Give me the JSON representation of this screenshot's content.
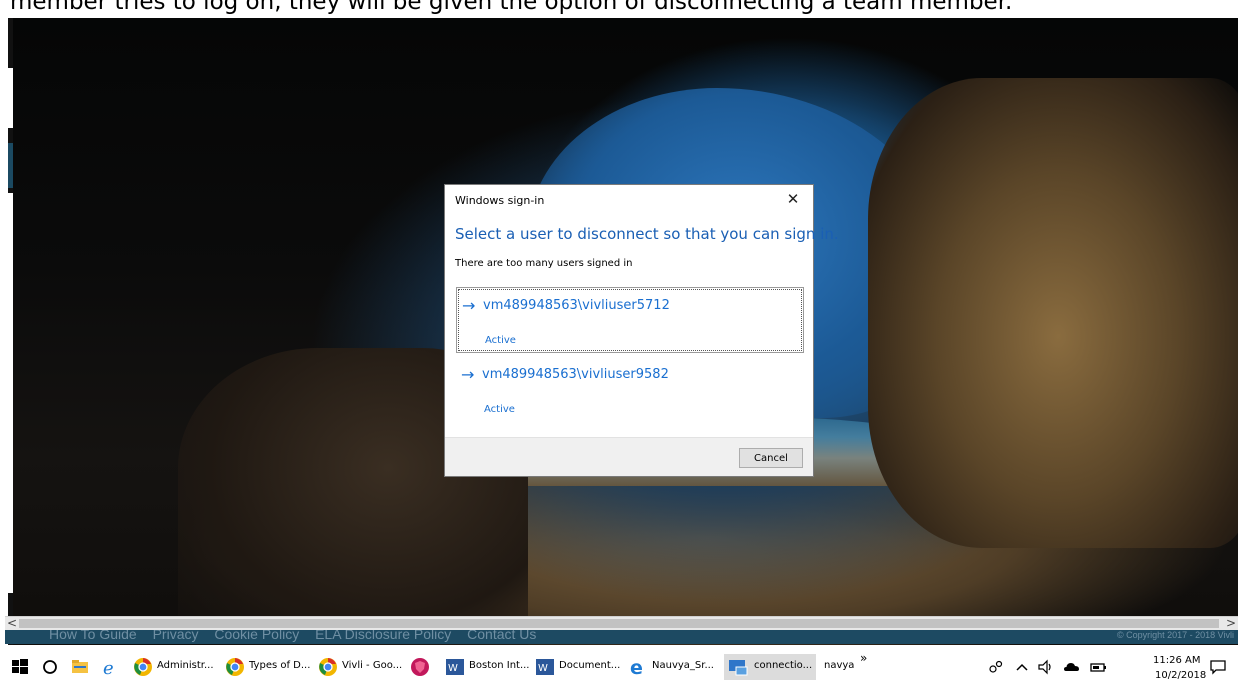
{
  "caption": {
    "text": "member tries to log on, they will be given the option of disconnecting a team member."
  },
  "dialog": {
    "title": "Windows sign-in",
    "close_glyph": "✕",
    "heading": "Select a user to disconnect so that you can sign in.",
    "subtext": "There are too many users signed in",
    "users": [
      {
        "arrow": "→",
        "name": "vm489948563\\vivliuser5712",
        "status": "Active",
        "selected": true
      },
      {
        "arrow": "→",
        "name": "vm489948563\\vivliuser9582",
        "status": "Active",
        "selected": false
      }
    ],
    "cancel_label": "Cancel"
  },
  "page_footer": {
    "links": [
      "How To Guide",
      "Privacy",
      "Cookie Policy",
      "ELA Disclosure Policy",
      "Contact Us"
    ],
    "copyright": "© Copyright 2017 - 2018 Vivli"
  },
  "scrollbar": {
    "left_arrow": "<",
    "right_arrow": ">"
  },
  "taskbar": {
    "apps": [
      {
        "label": "Administr...",
        "icon": "chrome-icon"
      },
      {
        "label": "Types of D...",
        "icon": "chrome-icon"
      },
      {
        "label": "Vivli - Goo...",
        "icon": "chrome-icon"
      },
      {
        "label": "",
        "icon": "shield-app-icon"
      },
      {
        "label": "Boston Int...",
        "icon": "word-icon"
      },
      {
        "label": "Document...",
        "icon": "word-icon"
      },
      {
        "label": "Nauvya_Sr...",
        "icon": "edge-icon"
      },
      {
        "label": "connectio...",
        "icon": "remote-desktop-icon"
      }
    ],
    "user_label": "navya",
    "overflow_glyph": "»",
    "time": "11:26 AM",
    "date": "10/2/2018"
  },
  "colors": {
    "dialog_accent": "#1a5fb4",
    "link_blue": "#1a6fd0",
    "footer_bg": "#1d4a62"
  }
}
